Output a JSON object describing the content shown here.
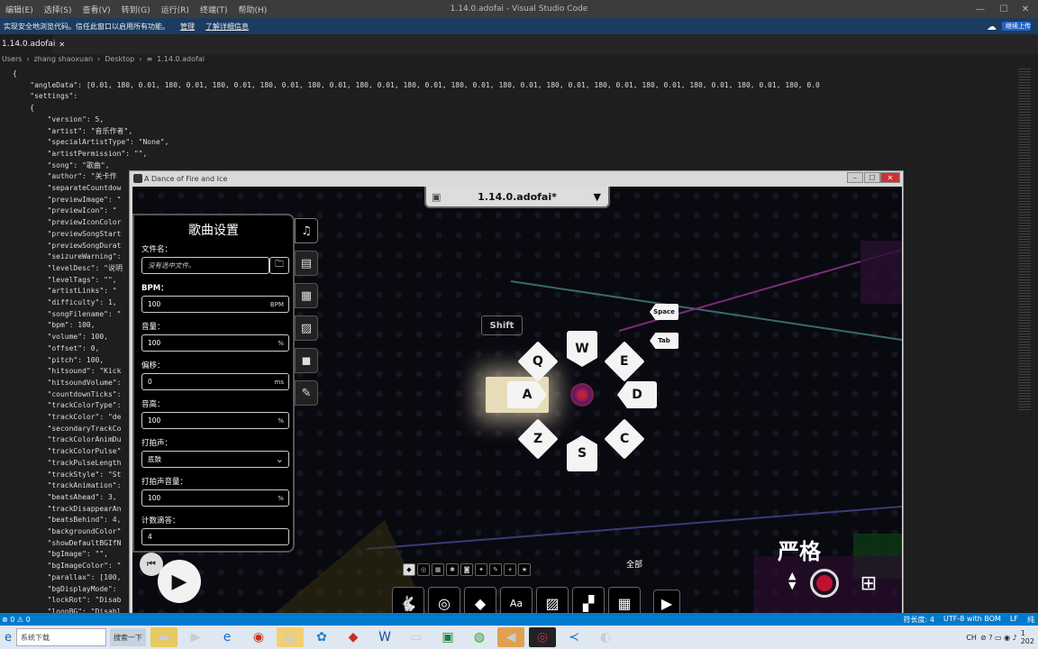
{
  "vscode": {
    "menu": [
      "编辑(E)",
      "选择(S)",
      "查看(V)",
      "转到(G)",
      "运行(R)",
      "终端(T)",
      "帮助(H)"
    ],
    "window_title": "1.14.0.adofai - Visual Studio Code",
    "window_controls": [
      "—",
      "☐",
      "✕"
    ],
    "banner": {
      "text": "实现安全地浏览代码。信任此窗口以启用所有功能。",
      "manage": "管理",
      "learn_more": "了解详细信息",
      "upload_label": "继续上传"
    },
    "tab_label": "1.14.0.adofai",
    "tab_close": "✕",
    "breadcrumb": [
      "Users",
      "zhang shaoxuan",
      "Desktop",
      "1.14.0.adofai"
    ],
    "code_lines": [
      "{",
      "    \"angleData\": [0.01, 180, 0.01, 180, 0.01, 180, 0.01, 180, 0.01, 180, 0.01, 180, 0.01, 180, 0.01, 180, 0.01, 180, 0.01, 180, 0.01, 180, 0.01, 180, 0.01, 180, 0.01, 180, 0.01, 180, 0.0",
      "    \"settings\":",
      "    {",
      "        \"version\": 5,",
      "        \"artist\": \"音乐作者\",",
      "        \"specialArtistType\": \"None\",",
      "        \"artistPermission\": \"\",",
      "        \"song\": \"歌曲\",",
      "        \"author\": \"关卡作",
      "        \"separateCountdow",
      "        \"previewImage\": \"",
      "        \"previewIcon\": \"",
      "        \"previewIconColor",
      "        \"previewSongStart",
      "        \"previewSongDurat",
      "        \"seizureWarning\":",
      "        \"levelDesc\": \"说明",
      "        \"levelTags\": \"\",",
      "        \"artistLinks\": \"",
      "        \"difficulty\": 1,",
      "        \"songFilename\": \"",
      "        \"bpm\": 100,",
      "        \"volume\": 100,",
      "        \"offset\": 0,",
      "        \"pitch\": 100,",
      "        \"hitsound\": \"Kick",
      "        \"hitsoundVolume\":",
      "        \"countdownTicks\":",
      "        \"trackColorType\":",
      "        \"trackColor\": \"de",
      "        \"secondaryTrackCo",
      "        \"trackColorAnimDu",
      "        \"trackColorPulse\"",
      "        \"trackPulseLength",
      "        \"trackStyle\": \"St",
      "        \"trackAnimation\":",
      "        \"beatsAhead\": 3,",
      "        \"trackDisappearAn",
      "        \"beatsBehind\": 4,",
      "        \"backgroundColor\"",
      "        \"showDefaultBGIfN",
      "        \"bgImage\": \"\",",
      "        \"bgImageColor\": \"",
      "        \"parallax\": [100,",
      "        \"bgDisplayMode\":",
      "        \"lockRot\": \"Disab",
      "        \"loopBG\": \"Disabl"
    ],
    "status": {
      "left": "⊗ 0 ⚠ 0",
      "right": [
        "符长度: 4",
        "UTF-8 with BOM",
        "LF",
        "纯"
      ]
    }
  },
  "game": {
    "window_title": "A Dance of Fire and Ice",
    "file_dropdown": "1.14.0.adofai*",
    "panel": {
      "title": "歌曲设置",
      "fields": [
        {
          "label": "文件名：",
          "value": "没有选中文件。",
          "unit": ""
        },
        {
          "label": "BPM：",
          "value": "100",
          "unit": "BPM"
        },
        {
          "label": "音量：",
          "value": "100",
          "unit": "%"
        },
        {
          "label": "偏移：",
          "value": "0",
          "unit": "ms"
        },
        {
          "label": "音高：",
          "value": "100",
          "unit": "%"
        },
        {
          "label": "打拍声：",
          "value": "底鼓",
          "unit": "⌄"
        },
        {
          "label": "打拍声音量：",
          "value": "100",
          "unit": "%"
        },
        {
          "label": "计数滴答：",
          "value": "4",
          "unit": ""
        }
      ]
    },
    "keys": {
      "shift": "Shift",
      "space": "Space",
      "tab": "Tab",
      "q": "Q",
      "w": "W",
      "e": "E",
      "a": "A",
      "d": "D",
      "z": "Z",
      "s": "S",
      "c": "C"
    },
    "bottom_all_label": "全部",
    "strict_label": "严格"
  },
  "taskbar": {
    "search_placeholder": "系统下载",
    "search_button": "搜索一下",
    "tray": "CH",
    "time": "1",
    "date": "202"
  },
  "colors": {
    "accent": "#007acc",
    "banner": "#1b3b60",
    "game_bg": "#090910"
  }
}
